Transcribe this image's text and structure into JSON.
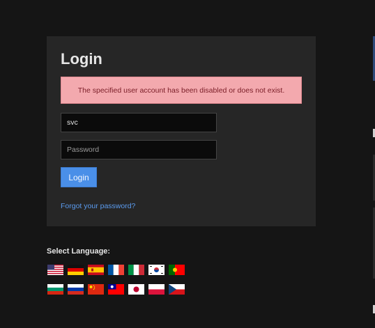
{
  "login": {
    "title": "Login",
    "error_message": "The specified user account has been disabled or does not exist.",
    "username_value": "svc",
    "password_placeholder": "Password",
    "login_button": "Login",
    "forgot_link": "Forgot your password?"
  },
  "language": {
    "heading": "Select Language:",
    "flags": [
      "us-flag-icon",
      "de-flag-icon",
      "es-flag-icon",
      "fr-flag-icon",
      "it-flag-icon",
      "kr-flag-icon",
      "pt-flag-icon",
      "bg-flag-icon",
      "ru-flag-icon",
      "cn-flag-icon",
      "tw-flag-icon",
      "jp-flag-icon",
      "pl-flag-icon",
      "cz-flag-icon"
    ]
  },
  "colors": {
    "background": "#151515",
    "panel": "#262626",
    "alert_bg": "#f3a9ae",
    "alert_text": "#7a1d27",
    "accent": "#4a8fe8",
    "link": "#5b9cf0"
  }
}
